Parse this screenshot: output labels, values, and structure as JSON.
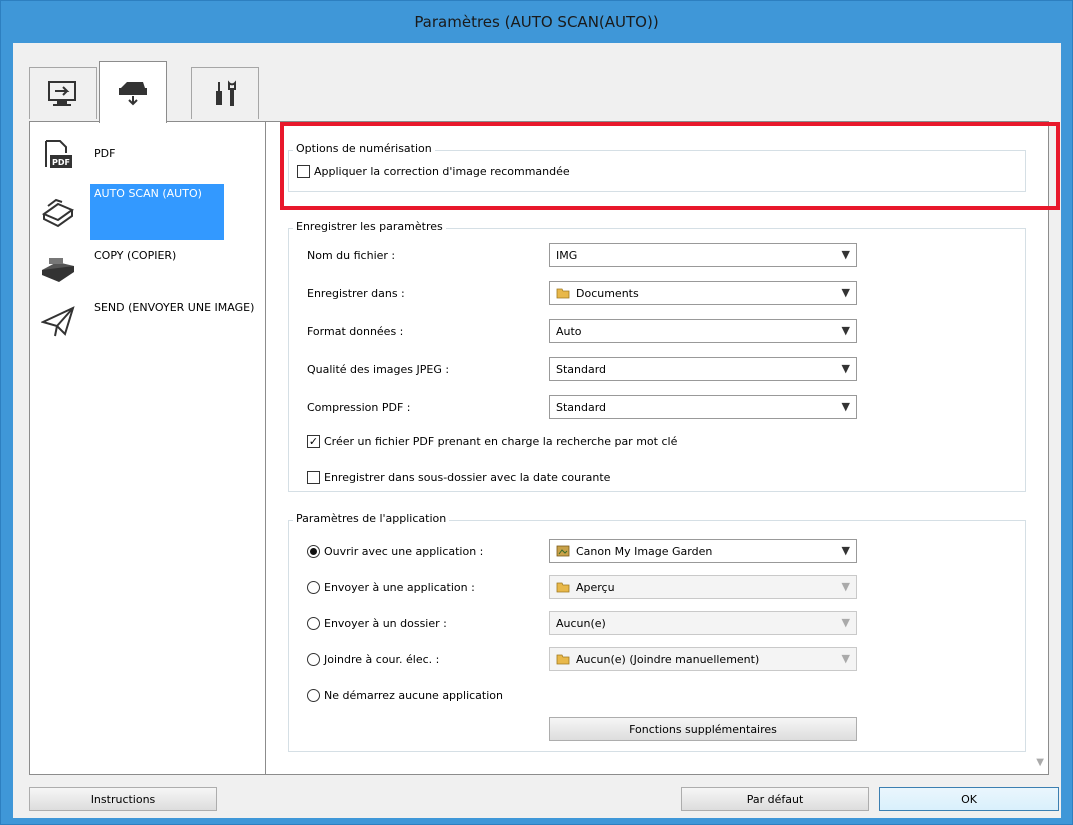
{
  "window": {
    "title": "Paramètres (AUTO SCAN(AUTO))"
  },
  "tabs": [
    {
      "name": "scan-from-computer-tab",
      "icon": "computer-scan-icon"
    },
    {
      "name": "scan-from-panel-tab",
      "icon": "scanner-icon",
      "active": true
    },
    {
      "name": "general-settings-tab",
      "icon": "tools-icon"
    }
  ],
  "sidebar": {
    "items": [
      {
        "label": "PDF",
        "icon": "pdf-document-icon"
      },
      {
        "label": "AUTO SCAN (AUTO)",
        "icon": "auto-scan-icon",
        "selected": true
      },
      {
        "label": "COPY (COPIER)",
        "icon": "copy-icon"
      },
      {
        "label": "SEND (ENVOYER UNE IMAGE)",
        "icon": "paper-plane-icon"
      }
    ]
  },
  "scan_options": {
    "title": "Options de numérisation",
    "apply_correction_label": "Appliquer la correction d'image recommandée",
    "apply_correction_checked": false
  },
  "save_settings": {
    "title": "Enregistrer les paramètres",
    "file_name_label": "Nom du fichier :",
    "file_name_value": "IMG",
    "save_in_label": "Enregistrer dans :",
    "save_in_value": "Documents",
    "data_format_label": "Format données :",
    "data_format_value": "Auto",
    "jpeg_quality_label": "Qualité des images JPEG :",
    "jpeg_quality_value": "Standard",
    "pdf_compression_label": "Compression PDF :",
    "pdf_compression_value": "Standard",
    "keyword_pdf_label": "Créer un fichier PDF prenant en charge la recherche par mot clé",
    "keyword_pdf_checked": true,
    "subfolder_label": "Enregistrer dans sous-dossier avec la date courante",
    "subfolder_checked": false
  },
  "app_settings": {
    "title": "Paramètres de l'application",
    "open_app_label": "Ouvrir avec une application :",
    "open_app_value": "Canon My Image Garden",
    "send_app_label": "Envoyer à une application :",
    "send_app_value": "Aperçu",
    "send_folder_label": "Envoyer à un dossier :",
    "send_folder_value": "Aucun(e)",
    "attach_email_label": "Joindre à cour. élec. :",
    "attach_email_value": "Aucun(e) (Joindre manuellement)",
    "no_app_label": "Ne démarrez aucune application",
    "selected_option": "open_app",
    "more_functions_label": "Fonctions supplémentaires"
  },
  "footer": {
    "instructions_label": "Instructions",
    "defaults_label": "Par défaut",
    "ok_label": "OK"
  },
  "colors": {
    "title_bar": "#3f97d8",
    "selection": "#3399ff",
    "highlight": "#e8182b"
  }
}
